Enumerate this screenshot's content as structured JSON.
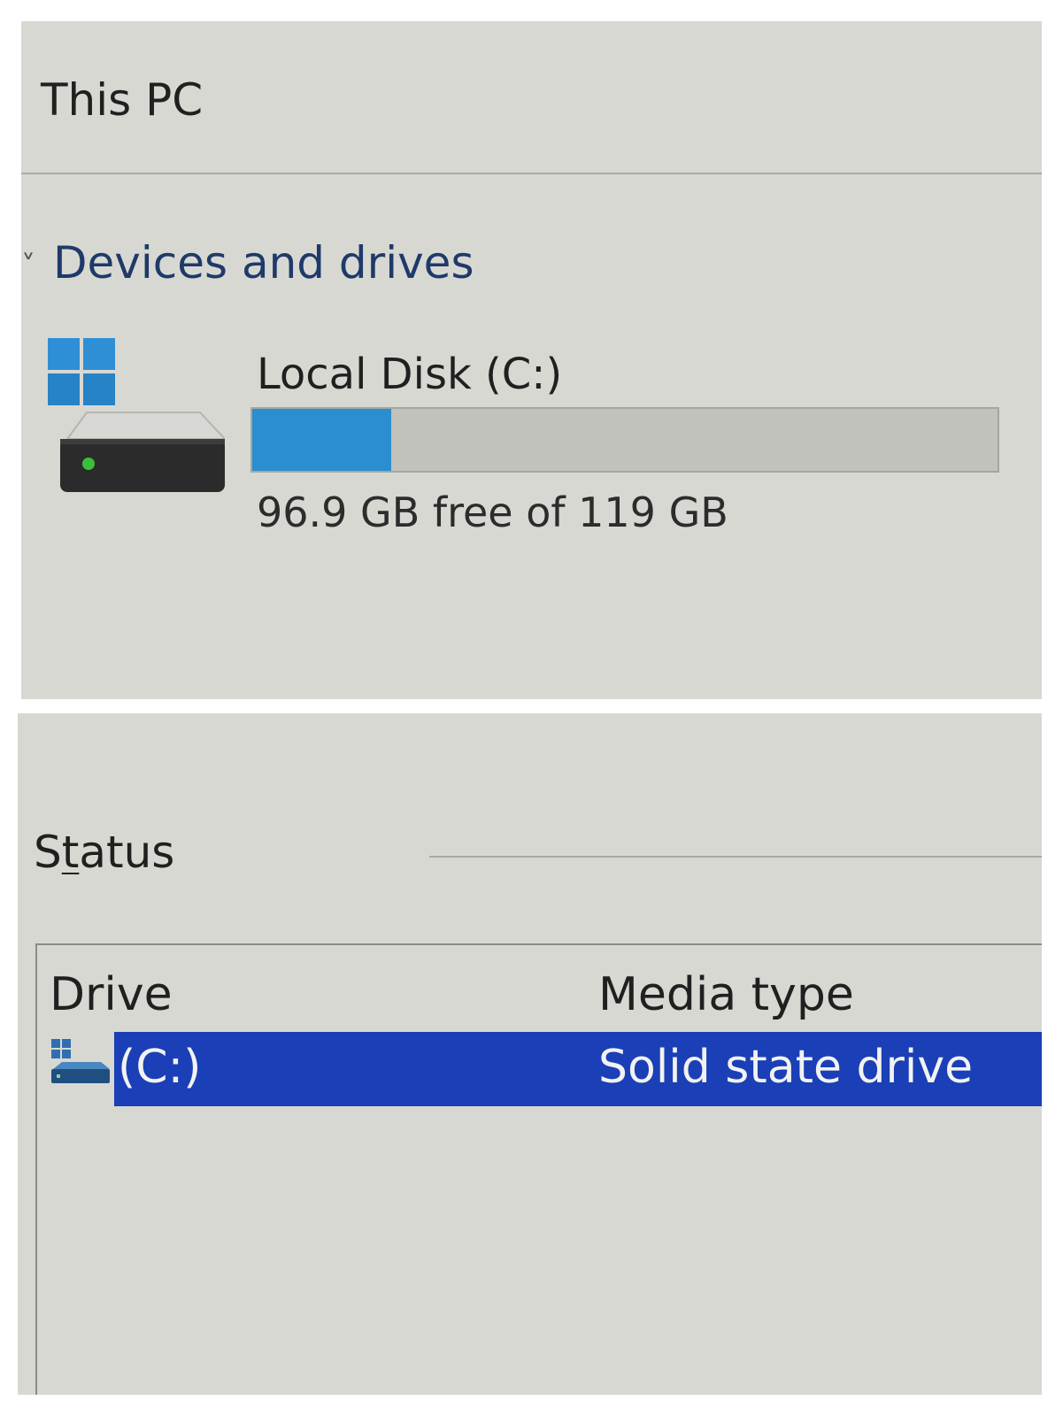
{
  "this_pc": {
    "title": "This PC",
    "section_header": "Devices and drives",
    "drive": {
      "name": "Local Disk (C:)",
      "free_text": "96.9 GB free of 119 GB",
      "used_fraction": 0.186,
      "bar_color": "#2a8ed0"
    }
  },
  "optimize_drives": {
    "status_label_prefix": "S",
    "status_label_underlined": "t",
    "status_label_suffix": "atus",
    "columns": {
      "drive": "Drive",
      "media_type": "Media type"
    },
    "rows": [
      {
        "drive": "(C:)",
        "media_type": "Solid state drive",
        "selected": true
      }
    ],
    "selection_color": "#1a3fb6"
  }
}
